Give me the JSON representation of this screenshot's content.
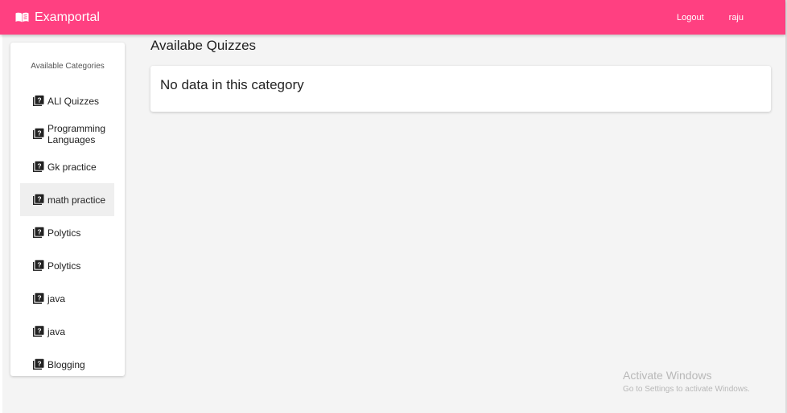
{
  "app": {
    "brand": "Examportal",
    "nav": {
      "logout": "Logout",
      "user": "raju"
    }
  },
  "sidebar": {
    "heading": "Available Categories",
    "items": [
      {
        "label": "ALl Quizzes",
        "icon": "quiz-icon"
      },
      {
        "label": "Programming Languages",
        "icon": "quiz-icon"
      },
      {
        "label": "Gk practice",
        "icon": "quiz-icon"
      },
      {
        "label": "math practice",
        "icon": "quiz-icon",
        "active": true
      },
      {
        "label": "Polytics",
        "icon": "quiz-icon"
      },
      {
        "label": "Polytics",
        "icon": "quiz-icon"
      },
      {
        "label": "java",
        "icon": "quiz-icon"
      },
      {
        "label": "java",
        "icon": "quiz-icon"
      },
      {
        "label": "Blogging",
        "icon": "quiz-icon"
      }
    ]
  },
  "main": {
    "title": "Availabe Quizzes",
    "empty_message": "No data in this category"
  },
  "watermark": {
    "title": "Activate Windows",
    "subtitle": "Go to Settings to activate Windows."
  },
  "colors": {
    "accent": "#ff4081",
    "background": "#f4f4f4"
  }
}
